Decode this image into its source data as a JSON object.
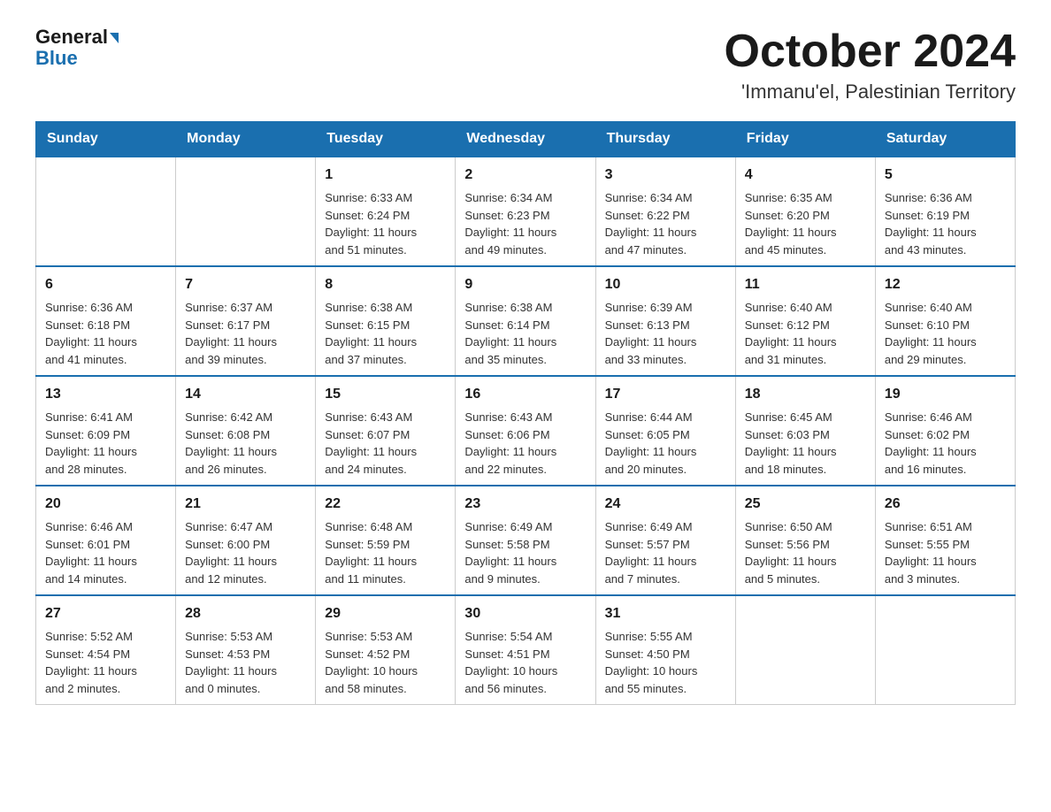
{
  "header": {
    "logo_general": "General",
    "logo_blue": "Blue",
    "month_year": "October 2024",
    "location": "'Immanu'el, Palestinian Territory"
  },
  "weekdays": [
    "Sunday",
    "Monday",
    "Tuesday",
    "Wednesday",
    "Thursday",
    "Friday",
    "Saturday"
  ],
  "weeks": [
    [
      {
        "day": "",
        "info": ""
      },
      {
        "day": "",
        "info": ""
      },
      {
        "day": "1",
        "info": "Sunrise: 6:33 AM\nSunset: 6:24 PM\nDaylight: 11 hours\nand 51 minutes."
      },
      {
        "day": "2",
        "info": "Sunrise: 6:34 AM\nSunset: 6:23 PM\nDaylight: 11 hours\nand 49 minutes."
      },
      {
        "day": "3",
        "info": "Sunrise: 6:34 AM\nSunset: 6:22 PM\nDaylight: 11 hours\nand 47 minutes."
      },
      {
        "day": "4",
        "info": "Sunrise: 6:35 AM\nSunset: 6:20 PM\nDaylight: 11 hours\nand 45 minutes."
      },
      {
        "day": "5",
        "info": "Sunrise: 6:36 AM\nSunset: 6:19 PM\nDaylight: 11 hours\nand 43 minutes."
      }
    ],
    [
      {
        "day": "6",
        "info": "Sunrise: 6:36 AM\nSunset: 6:18 PM\nDaylight: 11 hours\nand 41 minutes."
      },
      {
        "day": "7",
        "info": "Sunrise: 6:37 AM\nSunset: 6:17 PM\nDaylight: 11 hours\nand 39 minutes."
      },
      {
        "day": "8",
        "info": "Sunrise: 6:38 AM\nSunset: 6:15 PM\nDaylight: 11 hours\nand 37 minutes."
      },
      {
        "day": "9",
        "info": "Sunrise: 6:38 AM\nSunset: 6:14 PM\nDaylight: 11 hours\nand 35 minutes."
      },
      {
        "day": "10",
        "info": "Sunrise: 6:39 AM\nSunset: 6:13 PM\nDaylight: 11 hours\nand 33 minutes."
      },
      {
        "day": "11",
        "info": "Sunrise: 6:40 AM\nSunset: 6:12 PM\nDaylight: 11 hours\nand 31 minutes."
      },
      {
        "day": "12",
        "info": "Sunrise: 6:40 AM\nSunset: 6:10 PM\nDaylight: 11 hours\nand 29 minutes."
      }
    ],
    [
      {
        "day": "13",
        "info": "Sunrise: 6:41 AM\nSunset: 6:09 PM\nDaylight: 11 hours\nand 28 minutes."
      },
      {
        "day": "14",
        "info": "Sunrise: 6:42 AM\nSunset: 6:08 PM\nDaylight: 11 hours\nand 26 minutes."
      },
      {
        "day": "15",
        "info": "Sunrise: 6:43 AM\nSunset: 6:07 PM\nDaylight: 11 hours\nand 24 minutes."
      },
      {
        "day": "16",
        "info": "Sunrise: 6:43 AM\nSunset: 6:06 PM\nDaylight: 11 hours\nand 22 minutes."
      },
      {
        "day": "17",
        "info": "Sunrise: 6:44 AM\nSunset: 6:05 PM\nDaylight: 11 hours\nand 20 minutes."
      },
      {
        "day": "18",
        "info": "Sunrise: 6:45 AM\nSunset: 6:03 PM\nDaylight: 11 hours\nand 18 minutes."
      },
      {
        "day": "19",
        "info": "Sunrise: 6:46 AM\nSunset: 6:02 PM\nDaylight: 11 hours\nand 16 minutes."
      }
    ],
    [
      {
        "day": "20",
        "info": "Sunrise: 6:46 AM\nSunset: 6:01 PM\nDaylight: 11 hours\nand 14 minutes."
      },
      {
        "day": "21",
        "info": "Sunrise: 6:47 AM\nSunset: 6:00 PM\nDaylight: 11 hours\nand 12 minutes."
      },
      {
        "day": "22",
        "info": "Sunrise: 6:48 AM\nSunset: 5:59 PM\nDaylight: 11 hours\nand 11 minutes."
      },
      {
        "day": "23",
        "info": "Sunrise: 6:49 AM\nSunset: 5:58 PM\nDaylight: 11 hours\nand 9 minutes."
      },
      {
        "day": "24",
        "info": "Sunrise: 6:49 AM\nSunset: 5:57 PM\nDaylight: 11 hours\nand 7 minutes."
      },
      {
        "day": "25",
        "info": "Sunrise: 6:50 AM\nSunset: 5:56 PM\nDaylight: 11 hours\nand 5 minutes."
      },
      {
        "day": "26",
        "info": "Sunrise: 6:51 AM\nSunset: 5:55 PM\nDaylight: 11 hours\nand 3 minutes."
      }
    ],
    [
      {
        "day": "27",
        "info": "Sunrise: 5:52 AM\nSunset: 4:54 PM\nDaylight: 11 hours\nand 2 minutes."
      },
      {
        "day": "28",
        "info": "Sunrise: 5:53 AM\nSunset: 4:53 PM\nDaylight: 11 hours\nand 0 minutes."
      },
      {
        "day": "29",
        "info": "Sunrise: 5:53 AM\nSunset: 4:52 PM\nDaylight: 10 hours\nand 58 minutes."
      },
      {
        "day": "30",
        "info": "Sunrise: 5:54 AM\nSunset: 4:51 PM\nDaylight: 10 hours\nand 56 minutes."
      },
      {
        "day": "31",
        "info": "Sunrise: 5:55 AM\nSunset: 4:50 PM\nDaylight: 10 hours\nand 55 minutes."
      },
      {
        "day": "",
        "info": ""
      },
      {
        "day": "",
        "info": ""
      }
    ]
  ]
}
